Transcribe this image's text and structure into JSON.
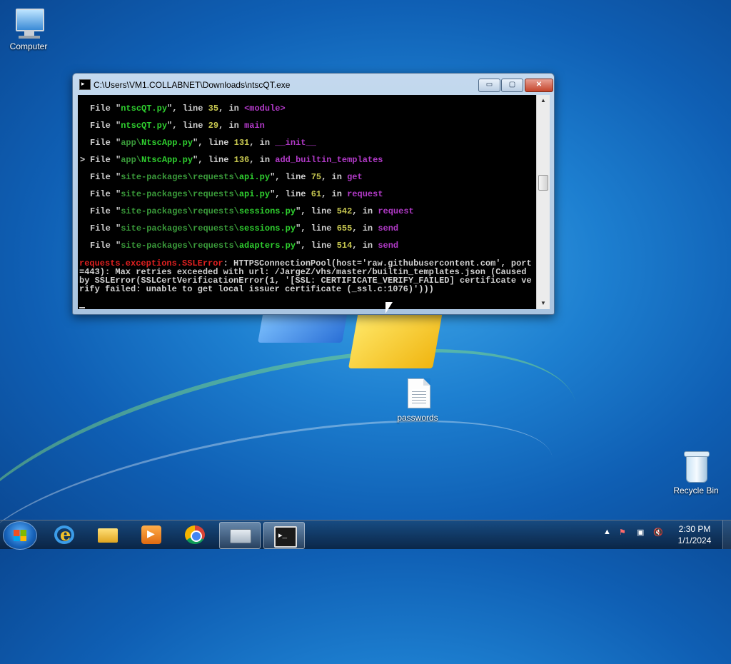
{
  "desktop": {
    "icons": [
      {
        "label": "Computer",
        "icon": "computer-icon"
      },
      {
        "label": "passwords",
        "icon": "text-document-icon"
      },
      {
        "label": "Recycle Bin",
        "icon": "recycle-bin-icon"
      }
    ]
  },
  "window": {
    "title": "C:\\Users\\VM1.COLLABNET\\Downloads\\ntscQT.exe",
    "buttons": {
      "minimize": "▭",
      "maximize": "▢",
      "close": "✕"
    }
  },
  "console": {
    "lines": [
      {
        "marker": "",
        "pre": "File \"",
        "dir": "",
        "file": "ntscQT.py",
        "mid": "\", line ",
        "num": "35",
        "sep": ", in ",
        "func": "<module>"
      },
      {
        "marker": "",
        "pre": "File \"",
        "dir": "",
        "file": "ntscQT.py",
        "mid": "\", line ",
        "num": "29",
        "sep": ", in ",
        "func": "main"
      },
      {
        "marker": "",
        "pre": "File \"",
        "dir": "app\\",
        "file": "NtscApp.py",
        "mid": "\", line ",
        "num": "131",
        "sep": ", in ",
        "func": "__init__"
      },
      {
        "marker": ">",
        "pre": "File \"",
        "dir": "app\\",
        "file": "NtscApp.py",
        "mid": "\", line ",
        "num": "136",
        "sep": ", in ",
        "func": "add_builtin_templates"
      },
      {
        "marker": "",
        "pre": "File \"",
        "dir": "site-packages\\requests\\",
        "file": "api.py",
        "mid": "\", line ",
        "num": "75",
        "sep": ", in ",
        "func": "get"
      },
      {
        "marker": "",
        "pre": "File \"",
        "dir": "site-packages\\requests\\",
        "file": "api.py",
        "mid": "\", line ",
        "num": "61",
        "sep": ", in ",
        "func": "request"
      },
      {
        "marker": "",
        "pre": "File \"",
        "dir": "site-packages\\requests\\",
        "file": "sessions.py",
        "mid": "\", line ",
        "num": "542",
        "sep": ", in ",
        "func": "request"
      },
      {
        "marker": "",
        "pre": "File \"",
        "dir": "site-packages\\requests\\",
        "file": "sessions.py",
        "mid": "\", line ",
        "num": "655",
        "sep": ", in ",
        "func": "send"
      },
      {
        "marker": "",
        "pre": "File \"",
        "dir": "site-packages\\requests\\",
        "file": "adapters.py",
        "mid": "\", line ",
        "num": "514",
        "sep": ", in ",
        "func": "send"
      }
    ],
    "error_type": "requests.exceptions.SSLError",
    "error_message": ": HTTPSConnectionPool(host='raw.githubusercontent.com', port=443): Max retries exceeded with url: /JargeZ/vhs/master/builtin_templates.json (Caused by SSLError(SSLCertVerificationError(1, '[SSL: CERTIFICATE_VERIFY_FAILED] certificate verify failed: unable to get local issuer certificate (_ssl.c:1076)')))"
  },
  "taskbar": {
    "items": [
      {
        "name": "internet-explorer",
        "icon": "internet-explorer-icon",
        "active": false
      },
      {
        "name": "file-explorer",
        "icon": "folder-icon",
        "active": false
      },
      {
        "name": "media-player",
        "icon": "media-player-icon",
        "active": false
      },
      {
        "name": "chrome",
        "icon": "chrome-icon",
        "active": false
      },
      {
        "name": "on-screen-keyboard",
        "icon": "keyboard-icon",
        "active": true
      },
      {
        "name": "command-prompt",
        "icon": "cmd-icon",
        "active": true
      }
    ],
    "tray": {
      "expand": "▲",
      "flag": "⚑",
      "network": "▣",
      "volume": "🔇"
    },
    "clock": {
      "time": "2:30 PM",
      "date": "1/1/2024"
    }
  },
  "colors": {
    "console_bg": "#000000",
    "file_name": "#2fd02f",
    "dir_path": "#3a9a3a",
    "function": "#b23ac8",
    "line_number": "#c8c850",
    "error_type": "#e02020"
  }
}
